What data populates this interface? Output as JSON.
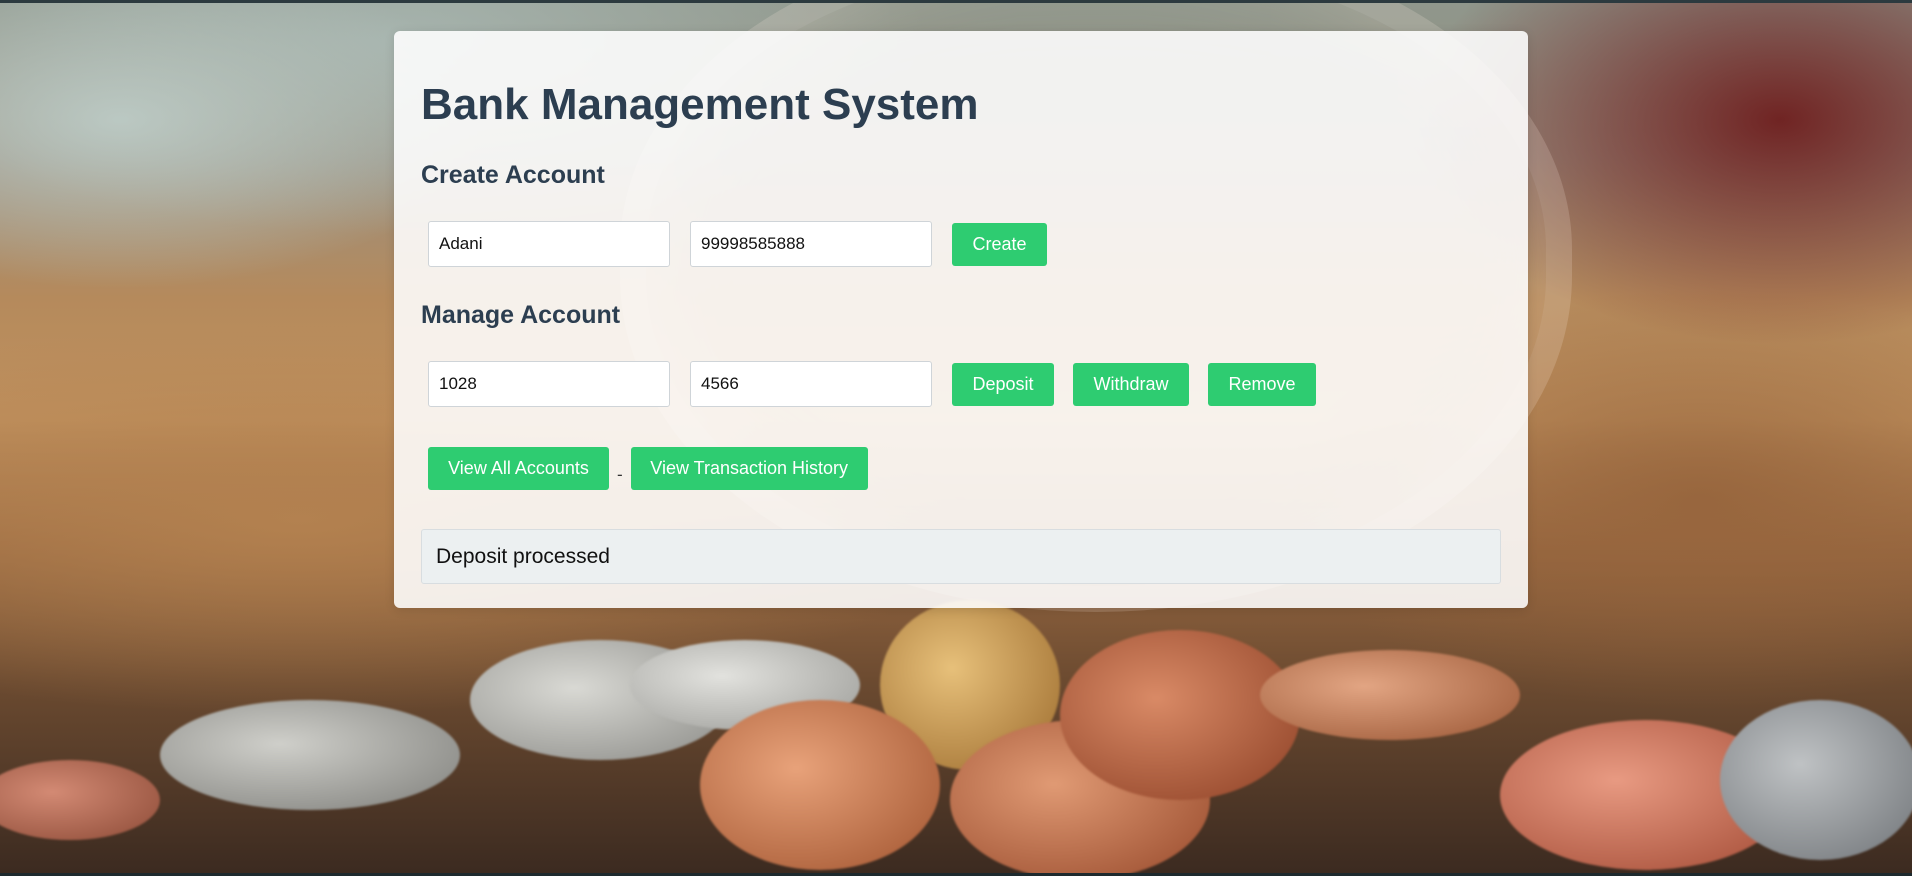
{
  "app": {
    "title": "Bank Management System"
  },
  "create_account": {
    "heading": "Create Account",
    "name_value": "Adani",
    "phone_value": "99998585888",
    "create_label": "Create"
  },
  "manage_account": {
    "heading": "Manage Account",
    "account_value": "1028",
    "amount_value": "4566",
    "deposit_label": "Deposit",
    "withdraw_label": "Withdraw",
    "remove_label": "Remove"
  },
  "views": {
    "view_all_label": "View All Accounts",
    "separator": "-",
    "view_history_label": "View Transaction History"
  },
  "status": {
    "message": "Deposit processed"
  },
  "colors": {
    "heading": "#2c3e50",
    "button": "#2ecc71",
    "message_bg": "#ecf0f1"
  }
}
